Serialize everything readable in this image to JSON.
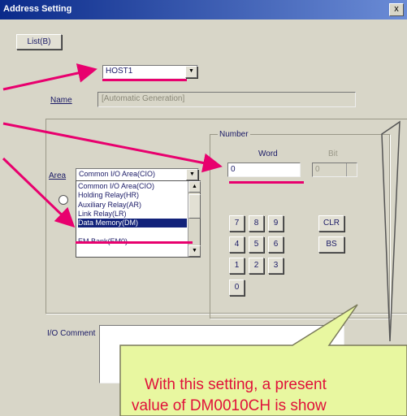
{
  "window": {
    "title": "Address Setting",
    "close_glyph": "x"
  },
  "toolbar": {
    "list_button": "List(B)"
  },
  "host": {
    "value": "HOST1"
  },
  "name_field": {
    "label": "Name",
    "value": "[Automatic Generation]"
  },
  "area": {
    "label": "Area",
    "value": "Common I/O Area(CIO)"
  },
  "area_options": [
    "Common I/O Area(CIO)",
    "Holding Relay(HR)",
    "Auxiliary Relay(AR)",
    "Link Relay(LR)",
    "Data Memory(DM)",
    "EM Bank(EM0)"
  ],
  "number_group": {
    "title": "Number",
    "word_label": "Word",
    "bit_label": "Bit",
    "word_value": "0",
    "bit_value": "0"
  },
  "keypad": {
    "k7": "7",
    "k8": "8",
    "k9": "9",
    "k4": "4",
    "k5": "5",
    "k6": "6",
    "k1": "1",
    "k2": "2",
    "k3": "3",
    "k0": "0",
    "clr": "CLR",
    "bs": "BS"
  },
  "io_comment": {
    "label": "I/O Comment"
  },
  "callout": {
    "line1": "With this setting, a present",
    "line2": "value of DM0010CH is show"
  },
  "colors": {
    "accent_pink": "#e8006e",
    "callout_bg": "#e8f7a0",
    "title_bar": "#0a2a8a",
    "selection": "#12227a"
  }
}
